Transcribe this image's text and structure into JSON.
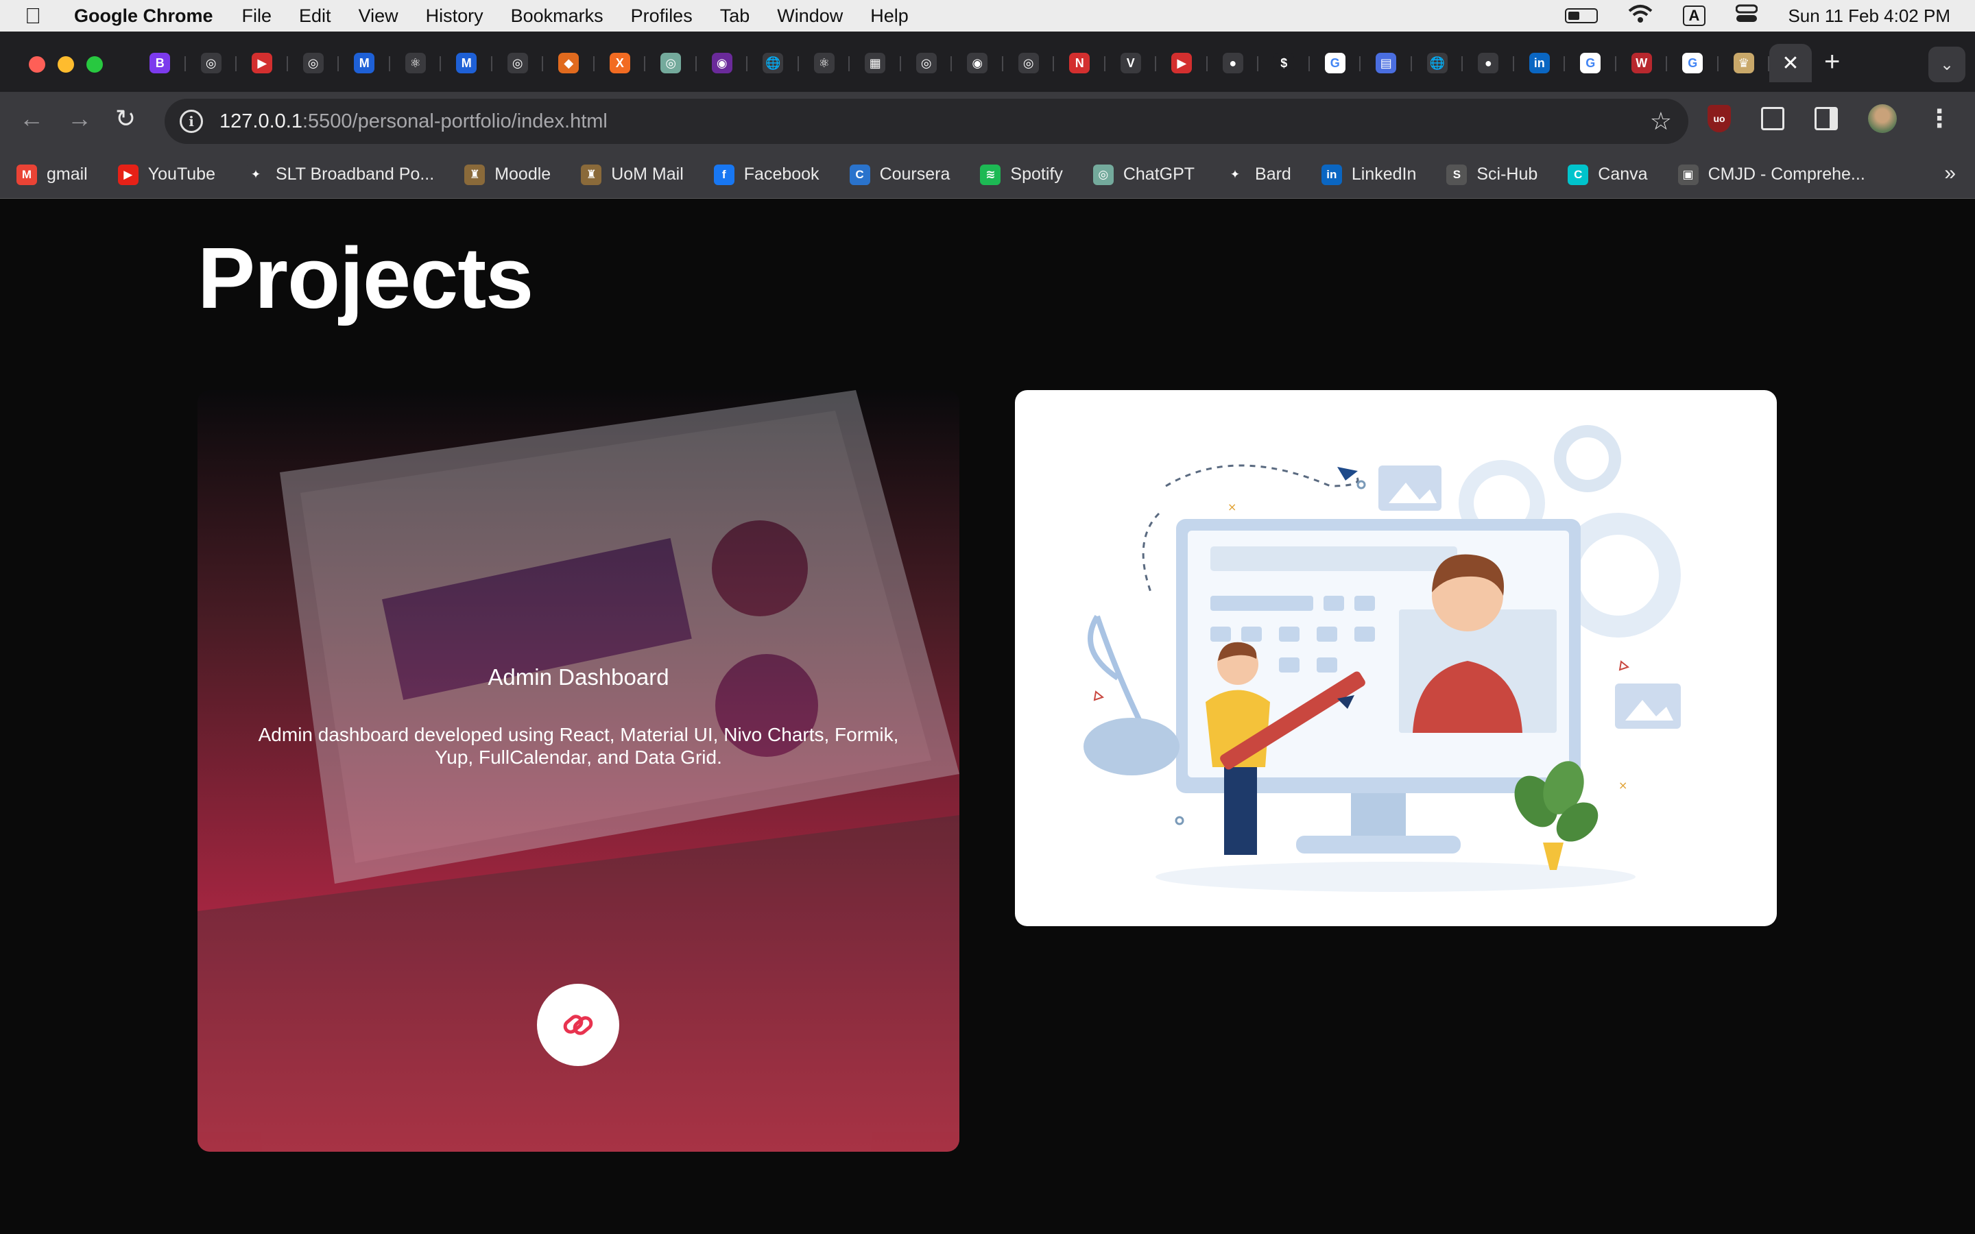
{
  "menubar": {
    "app_name": "Google Chrome",
    "menus": [
      "File",
      "Edit",
      "View",
      "History",
      "Bookmarks",
      "Profiles",
      "Tab",
      "Window",
      "Help"
    ],
    "datetime": "Sun 11 Feb  4:02 PM",
    "input_indicator": "A"
  },
  "tabs": {
    "favicons": [
      {
        "icon": "bootstrap-icon",
        "color": "#7c3aed",
        "glyph": "B"
      },
      {
        "icon": "chatgpt-icon",
        "color": "#3a3a3e",
        "glyph": "◎"
      },
      {
        "icon": "youtube-icon",
        "color": "#d32f2f",
        "glyph": "▶"
      },
      {
        "icon": "chatgpt-icon",
        "color": "#3a3a3e",
        "glyph": "◎"
      },
      {
        "icon": "mui-icon",
        "color": "#1e60d6",
        "glyph": "M"
      },
      {
        "icon": "react-icon",
        "color": "#3a3a3e",
        "glyph": "⚛"
      },
      {
        "icon": "mui-icon",
        "color": "#1e60d6",
        "glyph": "M"
      },
      {
        "icon": "chatgpt-icon",
        "color": "#3a3a3e",
        "glyph": "◎"
      },
      {
        "icon": "git-icon",
        "color": "#e06a1e",
        "glyph": "◆"
      },
      {
        "icon": "xampp-icon",
        "color": "#f26b22",
        "glyph": "X"
      },
      {
        "icon": "chatgpt-green-icon",
        "color": "#74aa9c",
        "glyph": "◎"
      },
      {
        "icon": "purple-globe-icon",
        "color": "#6a2a9a",
        "glyph": "◉"
      },
      {
        "icon": "globe-icon",
        "color": "#3a3a3e",
        "glyph": "🌐"
      },
      {
        "icon": "react-icon",
        "color": "#3a3a3e",
        "glyph": "⚛"
      },
      {
        "icon": "image-icon",
        "color": "#3a3a3e",
        "glyph": "▦"
      },
      {
        "icon": "chatgpt-icon",
        "color": "#3a3a3e",
        "glyph": "◎"
      },
      {
        "icon": "circle-list-icon",
        "color": "#3a3a3e",
        "glyph": "◉"
      },
      {
        "icon": "chatgpt-icon",
        "color": "#3a3a3e",
        "glyph": "◎"
      },
      {
        "icon": "netflix-icon",
        "color": "#d32f2f",
        "glyph": "N"
      },
      {
        "icon": "vercel-icon",
        "color": "#3a3a3e",
        "glyph": "V"
      },
      {
        "icon": "youtube-icon",
        "color": "#d32f2f",
        "glyph": "▶"
      },
      {
        "icon": "github-icon",
        "color": "#3a3a3e",
        "glyph": "●"
      },
      {
        "icon": "dollar-icon",
        "color": "#1f1f22",
        "glyph": "$"
      },
      {
        "icon": "google-icon",
        "color": "#ffffff",
        "glyph": "G"
      },
      {
        "icon": "docs-icon",
        "color": "#4a6ee0",
        "glyph": "▤"
      },
      {
        "icon": "globe-icon",
        "color": "#3a3a3e",
        "glyph": "🌐"
      },
      {
        "icon": "github-icon",
        "color": "#3a3a3e",
        "glyph": "●"
      },
      {
        "icon": "linkedin-icon",
        "color": "#0a66c2",
        "glyph": "in"
      },
      {
        "icon": "google-icon",
        "color": "#ffffff",
        "glyph": "G"
      },
      {
        "icon": "wsc-icon",
        "color": "#b8282e",
        "glyph": "W"
      },
      {
        "icon": "google-icon",
        "color": "#ffffff",
        "glyph": "G"
      },
      {
        "icon": "crest-icon",
        "color": "#c9a86a",
        "glyph": "♛"
      }
    ],
    "active_close": "✕"
  },
  "toolbar": {
    "url_host": "127.0.0.1",
    "url_rest": ":5500/personal-portfolio/index.html"
  },
  "bookmarks": [
    {
      "label": "gmail",
      "icon": "gmail-icon",
      "color": "#ea4335",
      "glyph": "M"
    },
    {
      "label": "YouTube",
      "icon": "youtube-icon",
      "color": "#e62117",
      "glyph": "▶"
    },
    {
      "label": "SLT Broadband Po...",
      "icon": "slt-icon",
      "color": "#3a3a3e",
      "glyph": "✦"
    },
    {
      "label": "Moodle",
      "icon": "moodle-icon",
      "color": "#8a6a3a",
      "glyph": "♜"
    },
    {
      "label": "UoM Mail",
      "icon": "uom-icon",
      "color": "#8a6a3a",
      "glyph": "♜"
    },
    {
      "label": "Facebook",
      "icon": "facebook-icon",
      "color": "#1877f2",
      "glyph": "f"
    },
    {
      "label": "Coursera",
      "icon": "coursera-icon",
      "color": "#2a73cc",
      "glyph": "C"
    },
    {
      "label": "Spotify",
      "icon": "spotify-icon",
      "color": "#1db954",
      "glyph": "≋"
    },
    {
      "label": "ChatGPT",
      "icon": "chatgpt-icon",
      "color": "#74aa9c",
      "glyph": "◎"
    },
    {
      "label": "Bard",
      "icon": "bard-icon",
      "color": "#3a3a3e",
      "glyph": "✦"
    },
    {
      "label": "LinkedIn",
      "icon": "linkedin-icon",
      "color": "#0a66c2",
      "glyph": "in"
    },
    {
      "label": "Sci-Hub",
      "icon": "scihub-icon",
      "color": "#555555",
      "glyph": "S"
    },
    {
      "label": "Canva",
      "icon": "canva-icon",
      "color": "#00c4cc",
      "glyph": "C"
    },
    {
      "label": "CMJD - Comprehe...",
      "icon": "cmjd-icon",
      "color": "#555555",
      "glyph": "▣"
    }
  ],
  "page": {
    "title": "Projects",
    "projects": [
      {
        "title": "Admin Dashboard",
        "description": "Admin dashboard developed using React, Material UI, Nivo Charts, Formik, Yup, FullCalendar, and Data Grid."
      }
    ]
  },
  "colors": {
    "accent": "#e8334f",
    "page_bg": "#0a0a0a"
  }
}
